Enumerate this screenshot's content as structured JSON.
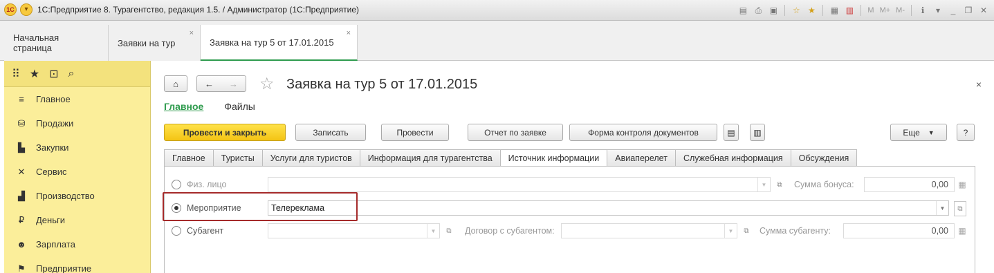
{
  "window": {
    "title": "1С:Предприятие 8. Турагентство, редакция 1.5. / Администратор  (1С:Предприятие)",
    "logo_text": "1С",
    "toolbar_text_icons": [
      "M",
      "M+",
      "M-"
    ]
  },
  "open_tabs": [
    {
      "label": "Начальная страница",
      "closable": false
    },
    {
      "label": "Заявки на тур",
      "closable": true
    },
    {
      "label": "Заявка на тур 5 от 17.01.2015",
      "closable": true,
      "active": true
    }
  ],
  "sidebar": {
    "top_icons": [
      "apps-grid-icon",
      "favorites-star-icon",
      "history-icon",
      "search-icon"
    ],
    "items": [
      {
        "label": "Главное",
        "icon": "menu-lines-icon"
      },
      {
        "label": "Продажи",
        "icon": "basket-icon"
      },
      {
        "label": "Закупки",
        "icon": "cart-icon"
      },
      {
        "label": "Сервис",
        "icon": "tools-icon"
      },
      {
        "label": "Производство",
        "icon": "factory-icon"
      },
      {
        "label": "Деньги",
        "icon": "ruble-coin-icon"
      },
      {
        "label": "Зарплата",
        "icon": "people-icon"
      },
      {
        "label": "Предприятие",
        "icon": "flag-icon"
      }
    ]
  },
  "form": {
    "title": "Заявка на тур 5 от 17.01.2015",
    "close_symbol": "×",
    "sub_tabs": [
      "Главное",
      "Файлы"
    ],
    "commands": {
      "post_and_close": "Провести и закрыть",
      "save": "Записать",
      "post": "Провести",
      "report": "Отчет по заявке",
      "control_form": "Форма контроля документов",
      "more": "Еще",
      "help": "?"
    },
    "field_tabs": [
      "Главное",
      "Туристы",
      "Услуги для туристов",
      "Информация для турагентства",
      "Источник информации",
      "Авиаперелет",
      "Служебная информация",
      "Обсуждения"
    ],
    "active_field_tab": "Источник информации",
    "source": {
      "individual_label": "Физ. лицо",
      "individual_value": "",
      "bonus_label": "Сумма бонуса:",
      "bonus_value": "0,00",
      "event_label": "Мероприятие",
      "event_value": "Телереклама",
      "subagent_label": "Субагент",
      "subagent_value": "",
      "contract_label": "Договор с субагентом:",
      "contract_value": "",
      "subagent_sum_label": "Сумма субагенту:",
      "subagent_sum_value": "0,00",
      "selected": "Мероприятие"
    }
  }
}
